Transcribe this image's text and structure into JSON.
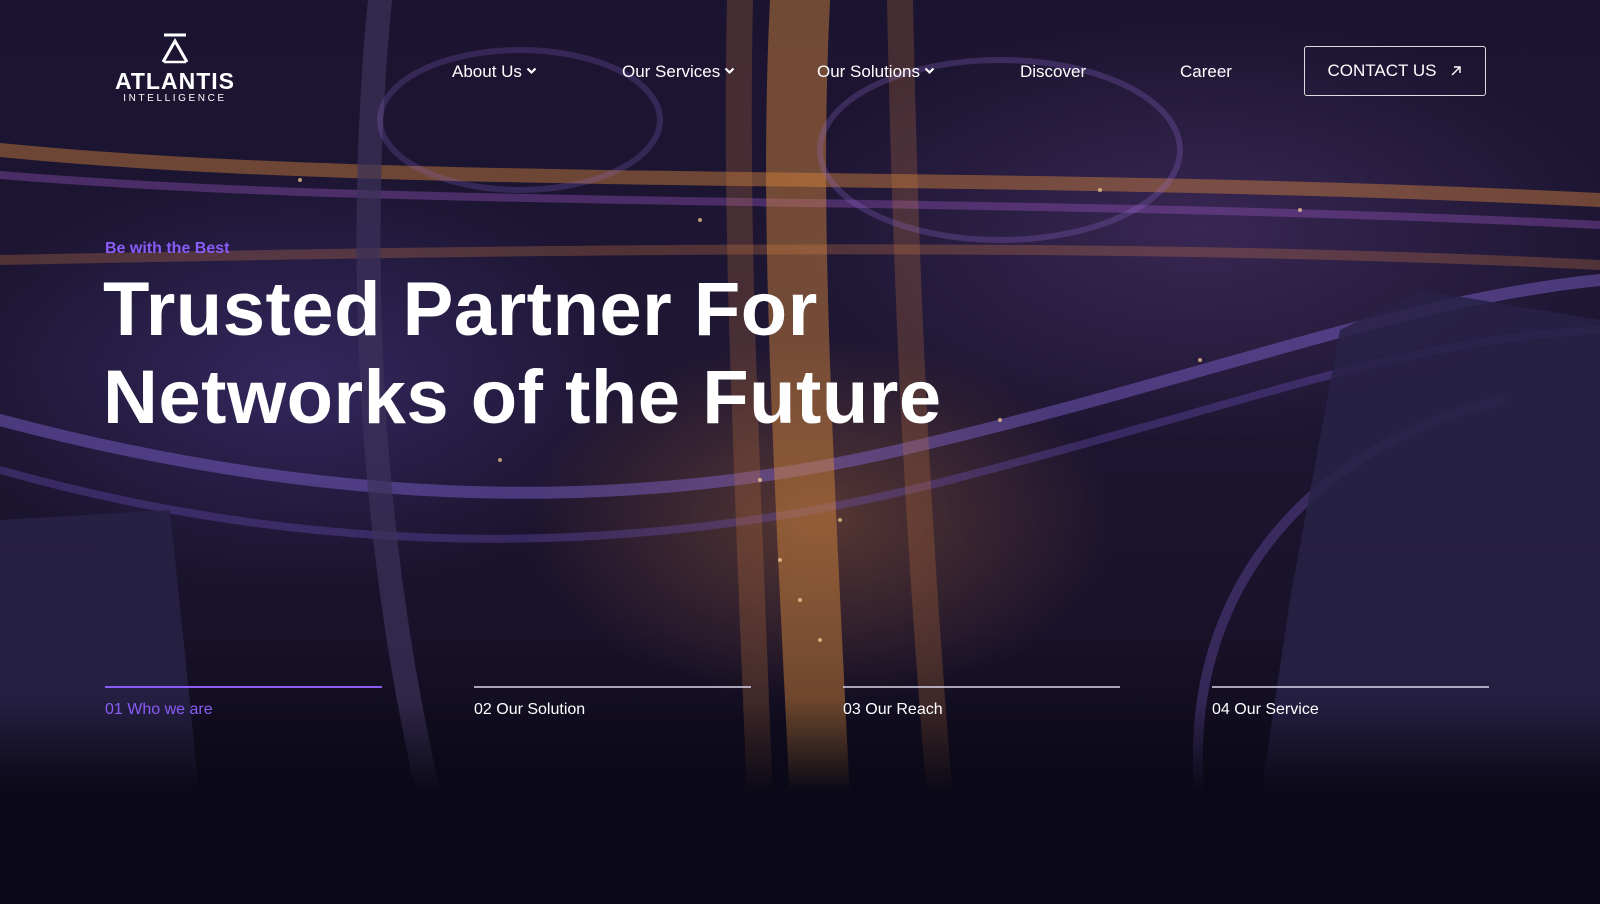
{
  "brand": {
    "name": "ATLANTIS",
    "tagline": "INTELLIGENCE"
  },
  "nav": {
    "items": [
      {
        "label": "About Us",
        "has_dropdown": true
      },
      {
        "label": "Our Services",
        "has_dropdown": true
      },
      {
        "label": "Our Solutions",
        "has_dropdown": true
      },
      {
        "label": "Discover",
        "has_dropdown": false
      },
      {
        "label": "Career",
        "has_dropdown": false
      }
    ],
    "contact_label": "CONTACT US"
  },
  "hero": {
    "eyebrow": "Be with the Best",
    "headline_line1": "Trusted Partner For",
    "headline_line2": "Networks of the Future"
  },
  "tabs": [
    {
      "label": "01 Who we are",
      "active": true
    },
    {
      "label": "02 Our Solution",
      "active": false
    },
    {
      "label": "03 Our Reach",
      "active": false
    },
    {
      "label": "04 Our Service",
      "active": false
    }
  ],
  "colors": {
    "accent": "#8a5cf6",
    "background": "#0b0917",
    "text": "#ffffff"
  },
  "icons": {
    "logo": "atlantis-a-mark-icon",
    "dropdown": "chevron-down-icon",
    "contact_arrow": "arrow-up-right-icon"
  }
}
